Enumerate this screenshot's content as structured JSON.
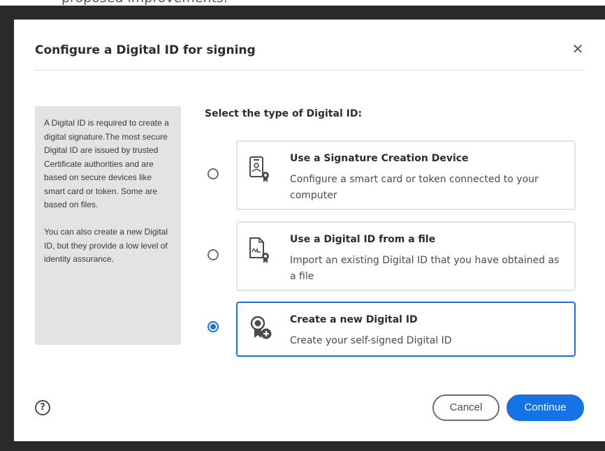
{
  "background": {
    "partial_text": "proposed improvements."
  },
  "dialog": {
    "title": "Configure a Digital ID for signing",
    "close_icon": "close-icon",
    "info_panel": {
      "paragraph1": "A Digital ID is required to create a digital signature.The most secure Digital ID are issued by trusted Certificate authorities and are based on secure devices like smart card or token. Some are based on files.",
      "paragraph2": "You can also create a new Digital ID, but they provide a low level of identity assurance."
    },
    "select_label": "Select the type of Digital ID:",
    "options": [
      {
        "title": "Use a Signature Creation Device",
        "description": "Configure a smart card or token connected to your computer",
        "icon": "signature-device-icon",
        "selected": false
      },
      {
        "title": "Use a Digital ID from a file",
        "description": "Import an existing Digital ID that you have obtained as a file",
        "icon": "digital-id-file-icon",
        "selected": false
      },
      {
        "title": "Create a new Digital ID",
        "description": "Create your self-signed Digital ID",
        "icon": "create-digital-id-icon",
        "selected": true
      }
    ],
    "help_label": "?",
    "cancel_label": "Cancel",
    "continue_label": "Continue"
  },
  "colors": {
    "accent": "#1473e6",
    "overlay": "#2a2a2a",
    "info_panel": "#e3e3e3"
  }
}
